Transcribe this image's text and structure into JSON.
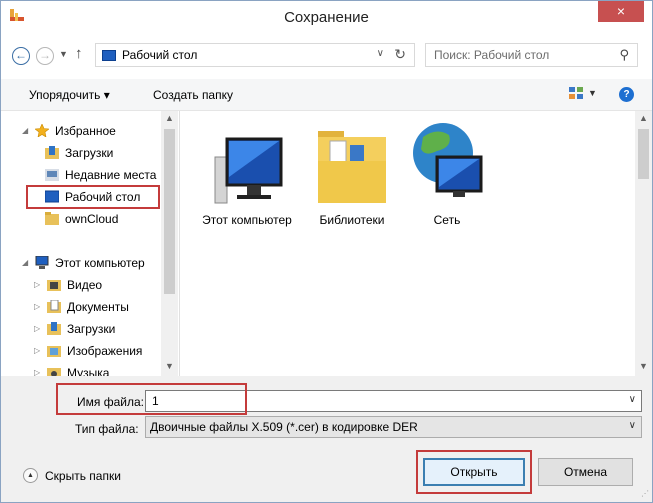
{
  "window": {
    "title": "Сохранение",
    "close_symbol": "×",
    "colors": {
      "close_bg": "#c75050",
      "highlight": "#c43b3b",
      "accent": "#3c7fb1"
    }
  },
  "nav": {
    "address": "Рабочий стол",
    "search_placeholder": "Поиск: Рабочий стол",
    "icons": [
      "back-arrow-icon",
      "forward-arrow-icon",
      "up-arrow-icon",
      "refresh-icon",
      "search-icon"
    ]
  },
  "toolbar": {
    "organize_label": "Упорядочить ▾",
    "new_folder_label": "Создать папку"
  },
  "sidebar": {
    "items": [
      {
        "label": "Избранное",
        "icon": "star-icon"
      },
      {
        "label": "Загрузки",
        "icon": "downloads-icon"
      },
      {
        "label": "Недавние места",
        "icon": "recent-places-icon"
      },
      {
        "label": "Рабочий стол",
        "icon": "desktop-icon"
      },
      {
        "label": "ownCloud",
        "icon": "folder-icon"
      },
      {
        "label": "Этот компьютер",
        "icon": "computer-icon"
      },
      {
        "label": "Видео",
        "icon": "video-icon"
      },
      {
        "label": "Документы",
        "icon": "documents-icon"
      },
      {
        "label": "Загрузки",
        "icon": "downloads-icon"
      },
      {
        "label": "Изображения",
        "icon": "pictures-icon"
      },
      {
        "label": "Музыка",
        "icon": "music-icon"
      }
    ]
  },
  "content": {
    "items": [
      {
        "label": "Этот компьютер",
        "icon": "computer-icon"
      },
      {
        "label": "Библиотеки",
        "icon": "libraries-icon"
      },
      {
        "label": "Сеть",
        "icon": "network-icon"
      }
    ]
  },
  "form": {
    "filename_label": "Имя файла:",
    "filename_value": "1",
    "filetype_label": "Тип файла:",
    "filetype_value": "Двоичные файлы X.509 (*.cer) в кодировке DER",
    "hide_folders_label": "Скрыть папки",
    "open_label": "Открыть",
    "cancel_label": "Отмена"
  }
}
